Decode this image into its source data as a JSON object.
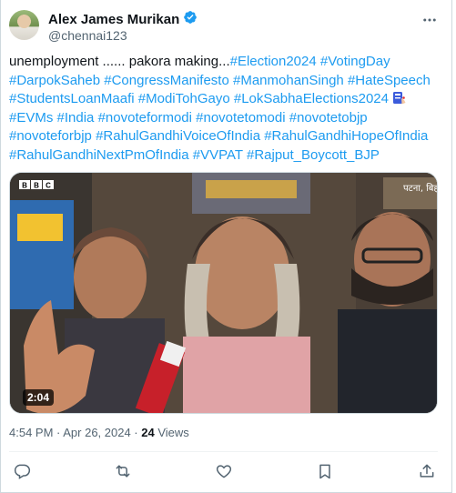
{
  "post": {
    "author_name": "Alex James Murikan",
    "author_handle": "@chennai123",
    "text_plain": "unemployment ...... pakora making...",
    "hashtags_line1": [
      "#Election2024",
      "#VotingDay"
    ],
    "hashtags_line2": [
      "#DarpokSaheb",
      "#CongressManifesto",
      "#ManmohanSingh",
      "#HateSpeech"
    ],
    "hashtags_line3": [
      "#StudentsLoanMaafi",
      "#ModiTohGayo",
      "#LokSabhaElections2024"
    ],
    "hashtags_line4": [
      "#EVMs",
      "#India",
      "#novoteformodi",
      "#novotetomodi",
      "#novotetobjp"
    ],
    "hashtags_line5": [
      "#novoteforbjp",
      "#RahulGandhiVoiceOfIndia",
      "#RahulGandhiHopeOfIndia"
    ],
    "hashtags_line6": [
      "#RahulGandhiNextPmOfIndia",
      "#VVPAT",
      "#Rajput_Boycott_BJP"
    ],
    "video_duration": "2:04",
    "video_watermark": "BBC",
    "video_location_tag": "पटना, बिहार",
    "timestamp": "4:54 PM · Apr 26, 2024 ·",
    "views_count": "24",
    "views_label": "Views"
  },
  "icons": {
    "verified": "verified-badge-icon",
    "more": "more-options-icon",
    "reply": "reply-icon",
    "retweet": "retweet-icon",
    "like": "heart-icon",
    "bookmark": "bookmark-icon",
    "share": "share-icon"
  },
  "colors": {
    "link": "#1d9bf0",
    "secondary_text": "#536471",
    "primary_text": "#0f1419"
  }
}
